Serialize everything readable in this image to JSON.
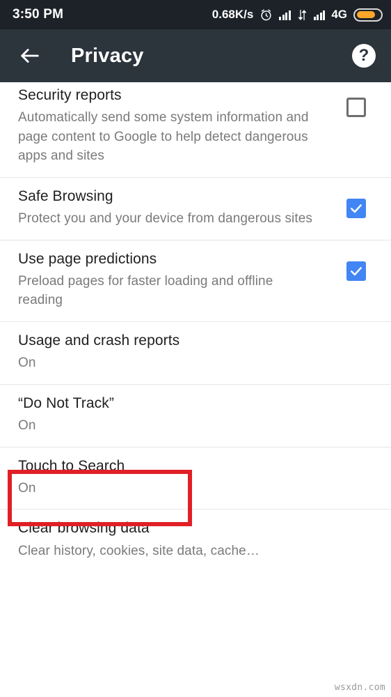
{
  "status_bar": {
    "clock": "3:50 PM",
    "network_speed": "0.68K/s",
    "alarm_icon": "alarm-clock-icon",
    "signal_icon_1": "signal-bars-icon",
    "data_transfer_icon": "data-transfer-icon",
    "signal_icon_2": "signal-bars-icon",
    "network_type": "4G",
    "battery_icon": "battery-icon",
    "battery_color": "#fca72b",
    "background_color": "#1d2228"
  },
  "toolbar": {
    "back_icon": "back-arrow-icon",
    "title": "Privacy",
    "help_label": "?",
    "background_color": "#2c343c"
  },
  "settings": {
    "accent_color": "#4285f4",
    "items": [
      {
        "title": "Security reports",
        "subtitle": "Automatically send some system information and page content to Google to help detect dangerous apps and sites",
        "control": "checkbox",
        "checked": false
      },
      {
        "title": "Safe Browsing",
        "subtitle": "Protect you and your device from dangerous sites",
        "control": "checkbox",
        "checked": true
      },
      {
        "title": "Use page predictions",
        "subtitle": "Preload pages for faster loading and offline reading",
        "control": "checkbox",
        "checked": true
      },
      {
        "title": "Usage and crash reports",
        "subtitle": "On",
        "control": "none",
        "checked": false
      },
      {
        "title": "“Do Not Track”",
        "subtitle": "On",
        "control": "none",
        "checked": false
      },
      {
        "title": "Touch to Search",
        "subtitle": "On",
        "control": "none",
        "checked": false
      },
      {
        "title": "Clear browsing data",
        "subtitle": "Clear history, cookies, site data, cache…",
        "control": "none",
        "checked": false
      }
    ]
  },
  "annotation": {
    "target": "“Do Not Track”",
    "color": "#e01f26"
  },
  "watermark": {
    "text": "wsxdn.com"
  }
}
